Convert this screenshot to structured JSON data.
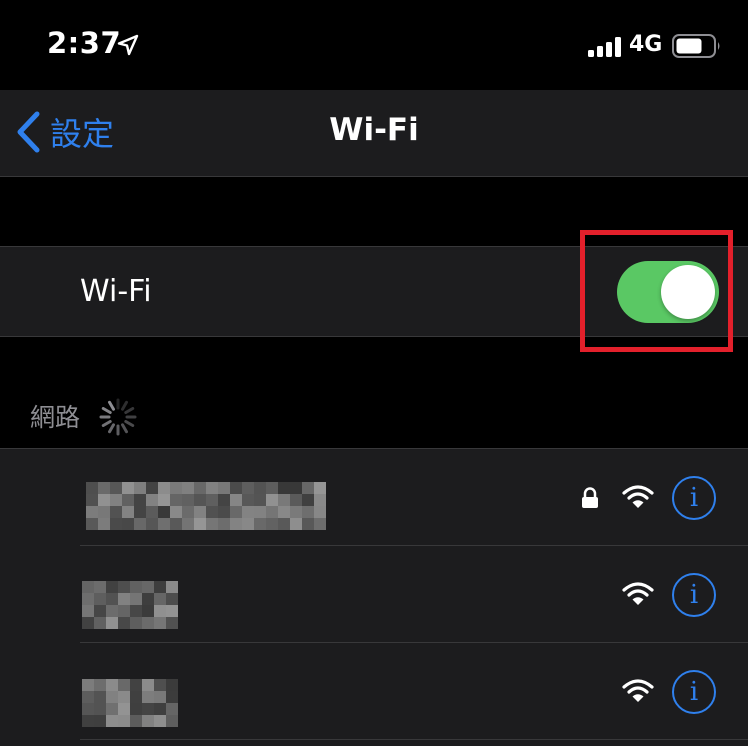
{
  "status_bar": {
    "time": "2:37",
    "network_type": "4G"
  },
  "nav": {
    "back_label": "設定",
    "title": "Wi-Fi"
  },
  "wifi_toggle": {
    "label": "Wi-Fi",
    "on": true
  },
  "networks_section": {
    "header": "網路"
  },
  "networks": [
    {
      "name": "",
      "secured": true
    },
    {
      "name": "",
      "secured": false
    },
    {
      "name": "",
      "secured": false
    }
  ],
  "colors": {
    "accent": "#2f80ed",
    "switch_on": "#5ac864",
    "highlight": "#e3202b",
    "cell_background": "#1c1c1e",
    "page_background": "#000000"
  },
  "icons": {
    "location": "location-arrow-icon",
    "signal": "cellular-signal-icon",
    "battery": "battery-icon",
    "lock": "lock-icon",
    "wifi": "wifi-strength-icon",
    "info": "info-icon",
    "spinner": "activity-spinner-icon"
  }
}
